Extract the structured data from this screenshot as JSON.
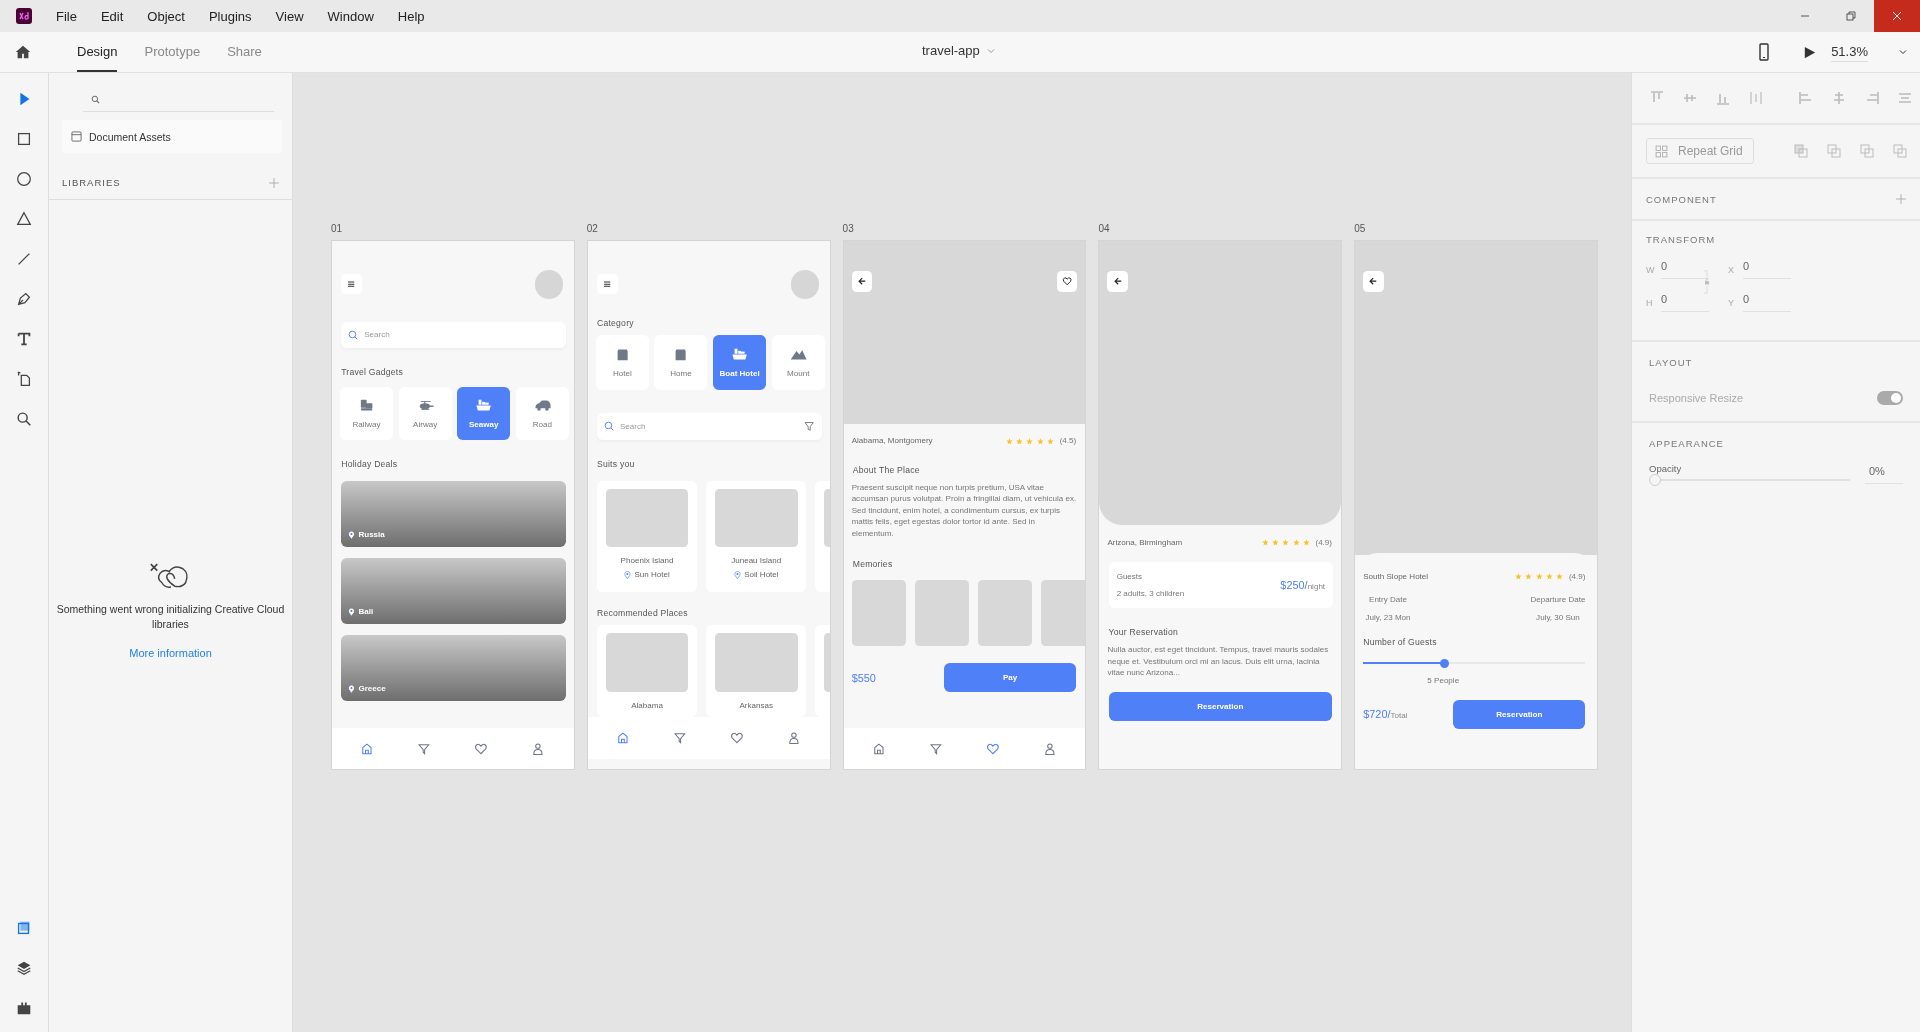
{
  "menu": [
    "File",
    "Edit",
    "Object",
    "Plugins",
    "View",
    "Window",
    "Help"
  ],
  "tabs": [
    {
      "label": "Design",
      "selected": true
    },
    {
      "label": "Prototype",
      "selected": false
    },
    {
      "label": "Share",
      "selected": false
    }
  ],
  "document_title": "travel-app",
  "zoom": "51.3%",
  "tools": [
    {
      "kind": "select",
      "selected": true
    },
    {
      "kind": "rectangle",
      "selected": false
    },
    {
      "kind": "ellipse",
      "selected": false
    },
    {
      "kind": "polygon",
      "selected": false
    },
    {
      "kind": "line",
      "selected": false
    },
    {
      "kind": "pen",
      "selected": false
    },
    {
      "kind": "text",
      "selected": false
    },
    {
      "kind": "artboard",
      "selected": false
    },
    {
      "kind": "zoom",
      "selected": false
    }
  ],
  "bottom_tools": [
    {
      "kind": "assets",
      "selected": true
    },
    {
      "kind": "layers",
      "selected": false
    },
    {
      "kind": "plugins",
      "selected": false
    }
  ],
  "assets_panel": {
    "document_assets": "Document Assets",
    "libraries_heading": "LIBRARIES",
    "error_message": "Something went wrong initializing Creative Cloud libraries",
    "link": "More information"
  },
  "artboards": [
    {
      "label": "01",
      "kind": "home",
      "search_placeholder": "Search",
      "gadgets_heading": "Travel Gadgets",
      "gadgets": [
        {
          "label": "Railway",
          "kind": "train",
          "selected": false
        },
        {
          "label": "Airway",
          "kind": "helicopter",
          "selected": false
        },
        {
          "label": "Seaway",
          "kind": "ship",
          "selected": true
        },
        {
          "label": "Road",
          "kind": "car",
          "selected": false
        }
      ],
      "deals_heading": "Holiday Deals",
      "deals": [
        "Russia",
        "Bali",
        "Greece"
      ],
      "nav": [
        {
          "kind": "home",
          "selected": true
        },
        {
          "kind": "filter",
          "selected": false
        },
        {
          "kind": "heart",
          "selected": false
        },
        {
          "kind": "user",
          "selected": false
        }
      ]
    },
    {
      "label": "02",
      "kind": "category",
      "category_heading": "Category",
      "categories": [
        {
          "label": "Hotel",
          "kind": "building",
          "selected": false
        },
        {
          "label": "Home",
          "kind": "building",
          "selected": false
        },
        {
          "label": "Boat Hotel",
          "kind": "ship",
          "selected": true
        },
        {
          "label": "Mount",
          "kind": "mountain",
          "selected": false
        }
      ],
      "search_placeholder": "Search",
      "suits_heading": "Suits you",
      "suits": [
        {
          "name": "Phoenix Island",
          "hotel": "Sun Hotel"
        },
        {
          "name": "Juneau Island",
          "hotel": "Soil Hotel"
        }
      ],
      "recommended_heading": "Recommended Places",
      "recommended": [
        "Alabama",
        "Arkansas"
      ],
      "nav": [
        {
          "kind": "home",
          "selected": true
        },
        {
          "kind": "filter",
          "selected": false
        },
        {
          "kind": "heart",
          "selected": false
        },
        {
          "kind": "user",
          "selected": false
        }
      ]
    },
    {
      "label": "03",
      "kind": "detail",
      "location": "Alabama, Montgomery",
      "stars": 5,
      "rating": "(4.5)",
      "about_heading": "About The Place",
      "about_text": "Praesent suscipit neque non turpis pretium, USA vitae accumsan purus volutpat. Proin a fringillai diam, ut vehicula ex. Sed tincidunt, enim hotel, a condimentum cursus, ex turpis mattis felis, eget egestas dolor tortor id ante. Sed in elementum.",
      "memories_heading": "Memories",
      "price": "$550",
      "button": "Pay",
      "nav": [
        {
          "kind": "home",
          "selected": false
        },
        {
          "kind": "filter",
          "selected": false
        },
        {
          "kind": "heart",
          "selected": true
        },
        {
          "kind": "user",
          "selected": false
        }
      ]
    },
    {
      "label": "04",
      "kind": "booking",
      "location": "Arizona, Birmingham",
      "stars": 5,
      "rating": "(4.9)",
      "guests_label": "Guests",
      "guests_value": "2 adults, 3 children",
      "price": "$250/",
      "price_unit": "night",
      "reservation_heading": "Your Reservation",
      "reservation_text": "Nulla auctor, est eget tincidunt. Tempus, travel mauris sodales neque et. Vestibulum orci mi an lacus. Duis elit urna, lacinia vitae nunc Arizona...",
      "button": "Reservation"
    },
    {
      "label": "05",
      "kind": "dates",
      "hotel": "South Slope Hotel",
      "stars": 5,
      "rating": "(4.9)",
      "entry_label": "Entry Date",
      "entry_value": "July, 23 Mon",
      "departure_label": "Departure Date",
      "departure_value": "July, 30 Sun",
      "guests_heading": "Number of Guests",
      "guests": {
        "level": 0.36
      },
      "guests_reading": "5 People",
      "price": "$720/",
      "price_unit": "Total",
      "button": "Reservation"
    }
  ],
  "properties": {
    "repeat_grid": "Repeat Grid",
    "component_heading": "COMPONENT",
    "transform_heading": "TRANSFORM",
    "fields": [
      {
        "label": "W",
        "value": "0"
      },
      {
        "label": "X",
        "value": "0"
      },
      {
        "label": "H",
        "value": "0"
      },
      {
        "label": "Y",
        "value": "0"
      }
    ],
    "layout_heading": "LAYOUT",
    "responsive_resize": {
      "label": "Responsive Resize",
      "on": true,
      "disabled": true
    },
    "appearance_heading": "APPEARANCE",
    "opacity": {
      "label": "Opacity",
      "level": 0,
      "value": "0%"
    }
  }
}
